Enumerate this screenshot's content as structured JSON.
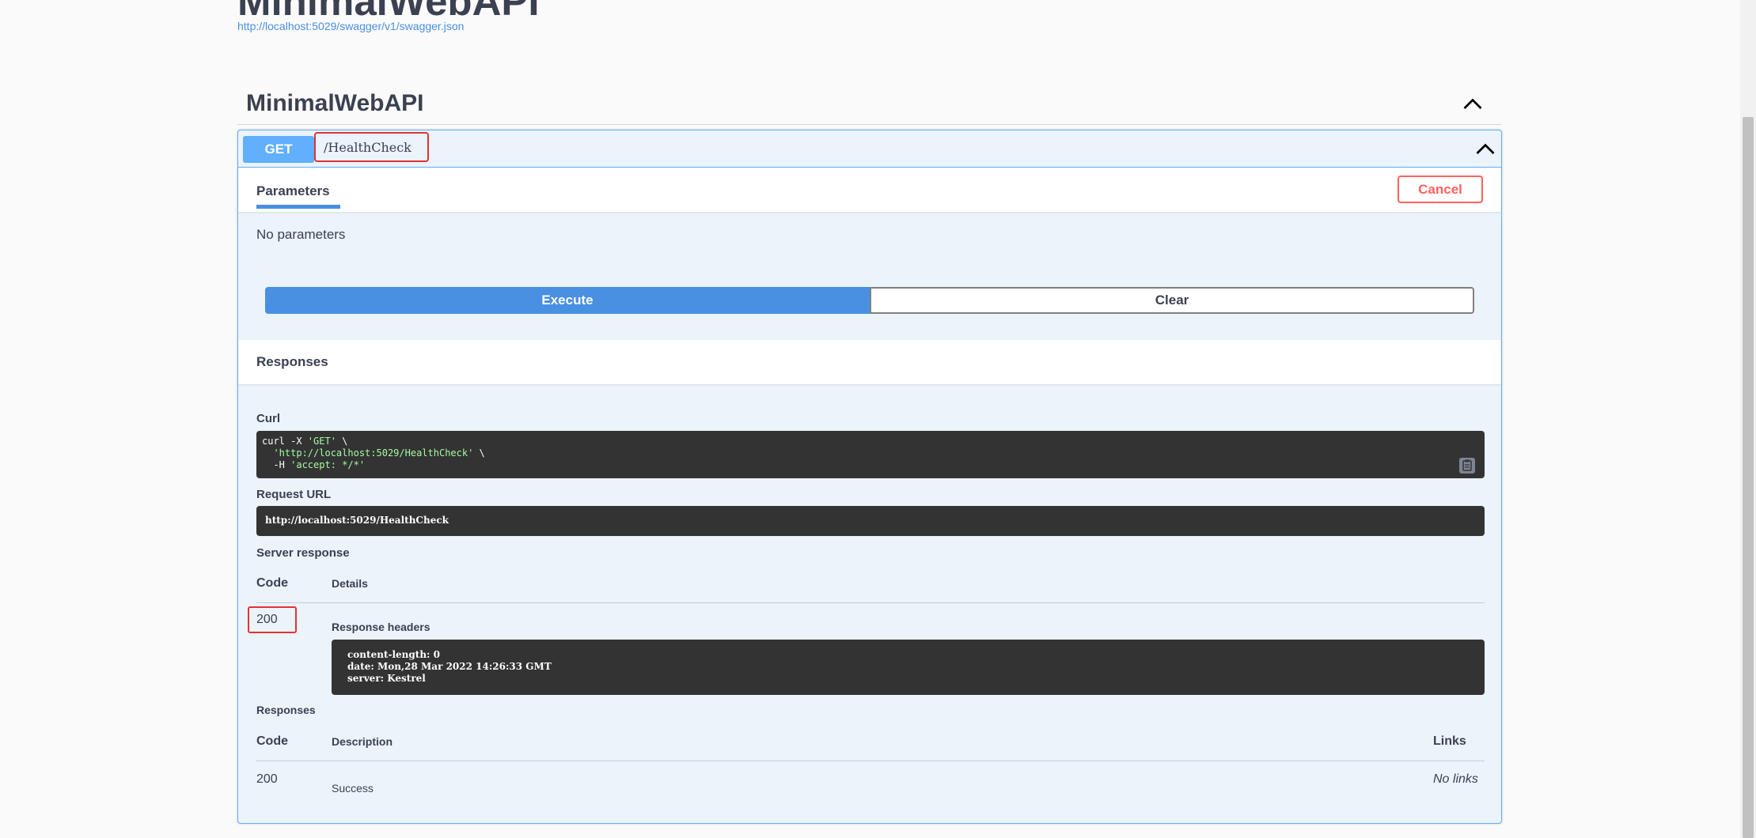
{
  "header": {
    "title": "MinimalWebAPI",
    "spec_url": "http://localhost:5029/swagger/v1/swagger.json"
  },
  "tag": {
    "name": "MinimalWebAPI"
  },
  "operation": {
    "method": "GET",
    "path": "/HealthCheck",
    "tab_label": "Parameters",
    "cancel_label": "Cancel",
    "no_params": "No parameters",
    "execute_label": "Execute",
    "clear_label": "Clear",
    "responses_title": "Responses"
  },
  "result": {
    "curl_label": "Curl",
    "curl_lines": {
      "line1_cmd": "curl -X ",
      "line1_str": "'GET'",
      "line1_tail": " \\",
      "line2_str": "  'http://localhost:5029/HealthCheck'",
      "line2_tail": " \\",
      "line3_cmd": "  -H ",
      "line3_str": "'accept: */*'"
    },
    "request_url_label": "Request URL",
    "request_url": "http://localhost:5029/HealthCheck",
    "server_response_label": "Server response",
    "code_header": "Code",
    "details_header": "Details",
    "status_code": "200",
    "response_headers_label": "Response headers",
    "response_headers": "content-length: 0\ndate: Mon,28 Mar 2022 14:26:33 GMT\nserver: Kestrel"
  },
  "responses": {
    "title": "Responses",
    "code_header": "Code",
    "description_header": "Description",
    "links_header": "Links",
    "rows": [
      {
        "code": "200",
        "description": "Success",
        "links": "No links"
      }
    ]
  },
  "colors": {
    "get_accent": "#61affe",
    "execute_blue": "#4990e2",
    "cancel_red": "#ff6060",
    "highlight_red": "#e03434",
    "code_bg": "#333333"
  }
}
